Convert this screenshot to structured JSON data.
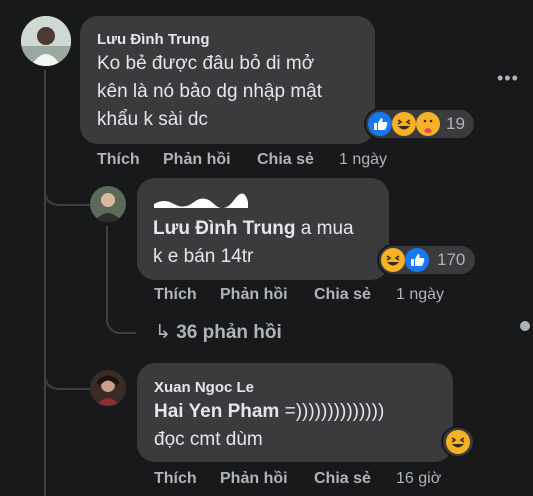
{
  "colors": {
    "background": "#18191a",
    "bubble": "#3a3b3c",
    "text": "#e4e6eb",
    "secondary": "#b0b3b8",
    "like_blue": "#1877f2",
    "haha_yellow": "#f7b125"
  },
  "comment1": {
    "author": "Lưu Đình Trung",
    "lines": [
      "Ko bẻ được đâu bỏ di mở",
      "kên là nó bảo dg nhập mật",
      "khẩu k sài dc"
    ],
    "reactions": {
      "icons": [
        "like-icon",
        "haha-icon",
        "care-icon"
      ],
      "count": "19"
    },
    "actions": {
      "like": "Thích",
      "reply": "Phản hồi",
      "share": "Chia sẻ",
      "time": "1 ngày"
    }
  },
  "comment2": {
    "mention": "Lưu Đình Trung",
    "text_after_mention": " a mua",
    "line2": "k e bán 14tr",
    "reactions": {
      "icons": [
        "haha-icon",
        "like-icon"
      ],
      "count": "170"
    },
    "actions": {
      "like": "Thích",
      "reply": "Phản hồi",
      "share": "Chia sẻ",
      "time": "1 ngày"
    },
    "view_replies": "36 phản hồi"
  },
  "comment3": {
    "author": "Xuan Ngoc Le",
    "mention": "Hai Yen Pham",
    "text_after_mention": " =))))))))))))))",
    "line2": "đọc cmt dùm",
    "reactions": {
      "icons": [
        "haha-icon"
      ]
    },
    "actions": {
      "like": "Thích",
      "reply": "Phản hồi",
      "share": "Chia sẻ",
      "time": "16 giờ"
    }
  }
}
